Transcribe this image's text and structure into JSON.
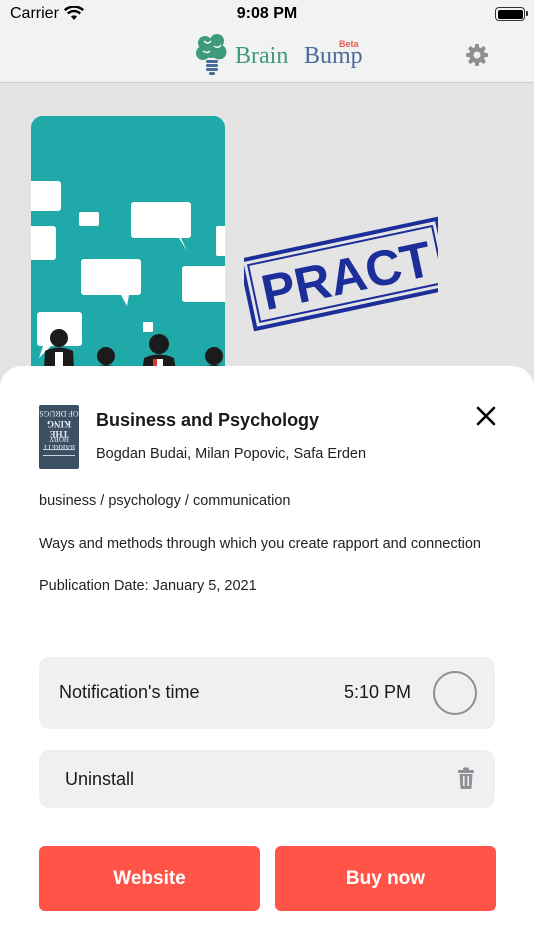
{
  "status_bar": {
    "carrier": "Carrier",
    "time": "9:08 PM"
  },
  "header": {
    "logo_brain": "Brain",
    "logo_bump": "Bump",
    "logo_beta": "Beta",
    "settings_icon": "gear-icon"
  },
  "background": {
    "stamp_text": "PRACT"
  },
  "book": {
    "thumb_line1": "OF DRUGS",
    "thumb_line2": "THE KING",
    "thumb_line3": "BARRETT HOBY",
    "title": "Business and Psychology",
    "authors": "Bogdan Budai, Milan Popovic, Safa Erden",
    "categories": "business / psychology / communication",
    "description": "Ways and methods through which you create rapport and connection",
    "publication_date": "Publication Date: January 5, 2021"
  },
  "notification": {
    "label": "Notification's time",
    "time": "5:10 PM"
  },
  "uninstall": {
    "label": "Uninstall"
  },
  "buttons": {
    "website": "Website",
    "buy_now": "Buy now"
  },
  "colors": {
    "accent": "#ff5447",
    "brand_green": "#3e9a7a",
    "brand_blue": "#4a6a9a",
    "cover_teal": "#1fa9a8"
  }
}
